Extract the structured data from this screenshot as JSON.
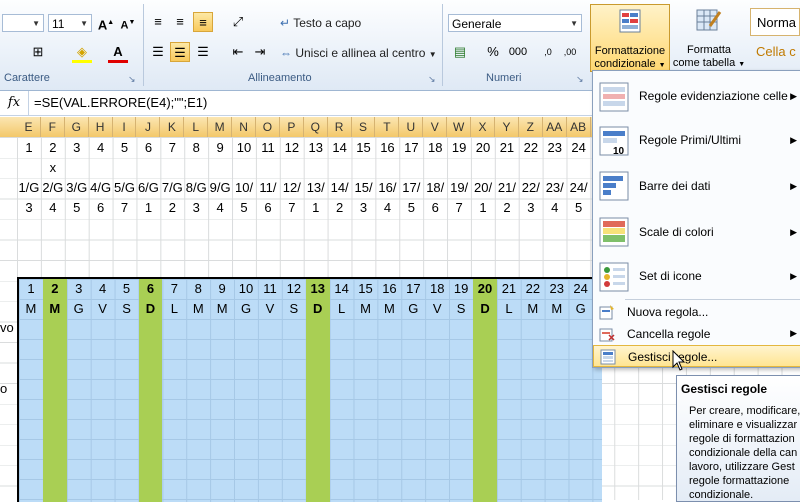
{
  "ribbon": {
    "font_size": "11",
    "font_grow": "A",
    "font_shrink": "A",
    "wrap_text": "Testo a capo",
    "merge_center": "Unisci e allinea al centro",
    "number_format": "Generale",
    "percent": "%",
    "thousands": "000",
    "cond_format_line1": "Formattazione",
    "cond_format_line2": "condizionale",
    "format_table_line1": "Formatta",
    "format_table_line2": "come tabella",
    "style_normal": "Norma",
    "style_cell": "Cella c",
    "groups": {
      "font": "Carattere",
      "align": "Allineamento",
      "number": "Numeri"
    }
  },
  "formula_bar": {
    "fx": "fx",
    "formula": "=SE(VAL.ERRORE(E4);\"\";E1)"
  },
  "columns": [
    "E",
    "F",
    "G",
    "H",
    "I",
    "J",
    "K",
    "L",
    "M",
    "N",
    "O",
    "P",
    "Q",
    "R",
    "S",
    "T",
    "U",
    "V",
    "W",
    "X",
    "Y",
    "Z",
    "AA",
    "AB"
  ],
  "rows_top": {
    "row1": [
      "1",
      "2",
      "3",
      "4",
      "5",
      "6",
      "7",
      "8",
      "9",
      "10",
      "11",
      "12",
      "13",
      "14",
      "15",
      "16",
      "17",
      "18",
      "19",
      "20",
      "21",
      "22",
      "23",
      "24"
    ],
    "row2_x": "x",
    "row4": [
      "1/G",
      "2/G",
      "3/G",
      "4/G",
      "5/G",
      "6/G",
      "7/G",
      "8/G",
      "9/G",
      "10/",
      "11/",
      "12/",
      "13/",
      "14/",
      "15/",
      "16/",
      "17/",
      "18/",
      "19/",
      "20/",
      "21/",
      "22/",
      "23/",
      "24/"
    ],
    "row5": [
      "3",
      "4",
      "5",
      "6",
      "7",
      "1",
      "2",
      "3",
      "4",
      "5",
      "6",
      "7",
      "1",
      "2",
      "3",
      "4",
      "5",
      "6",
      "7",
      "1",
      "2",
      "3",
      "4",
      "5"
    ]
  },
  "calendar": {
    "days": [
      "1",
      "2",
      "3",
      "4",
      "5",
      "6",
      "7",
      "8",
      "9",
      "10",
      "11",
      "12",
      "13",
      "14",
      "15",
      "16",
      "17",
      "18",
      "19",
      "20",
      "21",
      "22",
      "23",
      "24"
    ],
    "weekdays": [
      "M",
      "M",
      "G",
      "V",
      "S",
      "D",
      "L",
      "M",
      "M",
      "G",
      "V",
      "S",
      "D",
      "L",
      "M",
      "M",
      "G",
      "V",
      "S",
      "D",
      "L",
      "M",
      "M",
      "G"
    ],
    "left_labels": [
      "vo",
      "o"
    ]
  },
  "menu": {
    "items": [
      {
        "label": "Regole evidenziazione celle",
        "icon": "highlight-rules-icon"
      },
      {
        "label": "Regole Primi/Ultimi",
        "icon": "top-bottom-icon"
      },
      {
        "label": "Barre dei dati",
        "icon": "data-bars-icon"
      },
      {
        "label": "Scale di colori",
        "icon": "color-scales-icon"
      },
      {
        "label": "Set di icone",
        "icon": "icon-sets-icon"
      },
      {
        "label": "Nuova regola...",
        "icon": "new-rule-icon"
      },
      {
        "label": "Cancella regole",
        "icon": "clear-rules-icon"
      },
      {
        "label": "Gestisci regole...",
        "icon": "manage-rules-icon"
      }
    ],
    "top_bottom_badge": "10"
  },
  "tooltip": {
    "title": "Gestisci regole",
    "lines": [
      "Per creare, modificare,",
      "eliminare e visualizzar",
      "regole di formattazion",
      "condizionale della can",
      "lavoro, utilizzare Gest",
      "regole formattazione",
      "condizionale."
    ]
  },
  "colors": {
    "accent": "#f8c95c",
    "weekend": "#a9cf54",
    "calendar_bg": "#bcdcf7"
  }
}
